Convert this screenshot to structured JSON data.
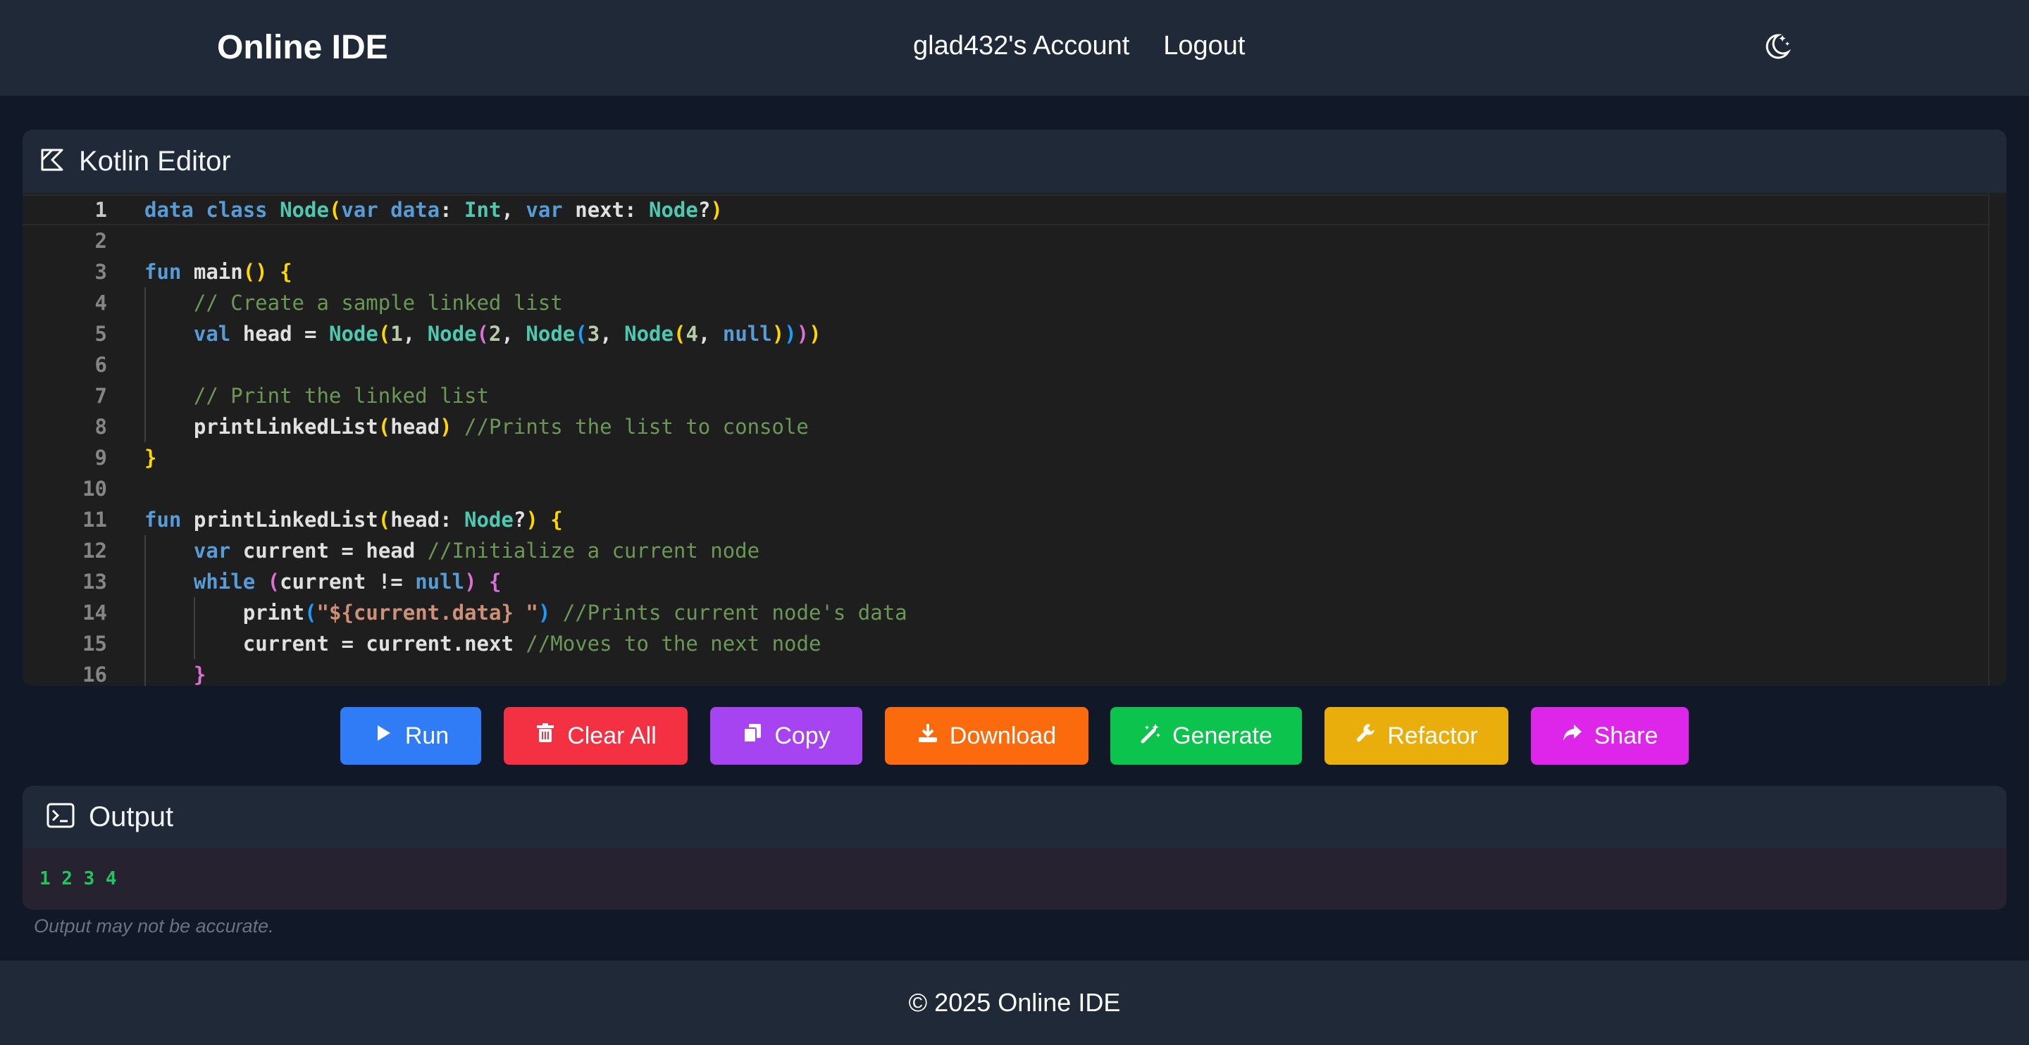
{
  "header": {
    "brand": "Online IDE",
    "account_link": "glad432's Account",
    "logout_link": "Logout",
    "theme_icon": "moon-stars-icon"
  },
  "editor": {
    "title": "Kotlin Editor",
    "language_icon": "kotlin-icon",
    "active_line": 1,
    "line_numbers": [
      "1",
      "2",
      "3",
      "4",
      "5",
      "6",
      "7",
      "8",
      "9",
      "10",
      "11",
      "12",
      "13",
      "14",
      "15",
      "16"
    ],
    "lines": [
      "data class Node(var data: Int, var next: Node?)",
      "",
      "fun main() {",
      "    // Create a sample linked list",
      "    val head = Node(1, Node(2, Node(3, Node(4, null))))",
      "",
      "    // Print the linked list",
      "    printLinkedList(head) //Prints the list to console",
      "}",
      "",
      "fun printLinkedList(head: Node?) {",
      "    var current = head //Initialize a current node",
      "    while (current != null) {",
      "        print(\"${current.data} \") //Prints current node's data",
      "        current = current.next //Moves to the next node",
      "    }"
    ]
  },
  "toolbar": {
    "buttons": [
      {
        "label": "Run",
        "icon": "play-icon",
        "color": "#2f7cf6"
      },
      {
        "label": "Clear All",
        "icon": "trash-icon",
        "color": "#f43043"
      },
      {
        "label": "Copy",
        "icon": "copy-icon",
        "color": "#a744f2"
      },
      {
        "label": "Download",
        "icon": "download-icon",
        "color": "#fb6a0c"
      },
      {
        "label": "Generate",
        "icon": "magic-wand-icon",
        "color": "#0cc34d"
      },
      {
        "label": "Refactor",
        "icon": "wrench-icon",
        "color": "#eaae0c"
      },
      {
        "label": "Share",
        "icon": "share-icon",
        "color": "#de26ea"
      }
    ]
  },
  "output": {
    "title": "Output",
    "icon": "terminal-icon",
    "text": "1 2 3 4",
    "disclaimer": "Output may not be accurate."
  },
  "footer": {
    "text": "© 2025 Online IDE"
  }
}
